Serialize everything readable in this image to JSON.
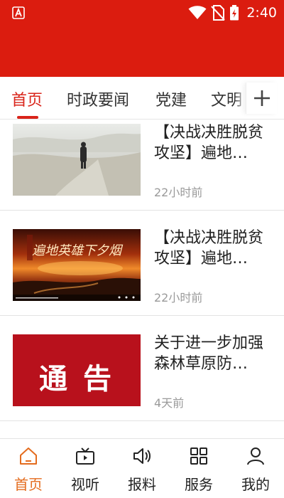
{
  "status_bar": {
    "time": "2:40",
    "left_icon": "app-notification-icon",
    "right_icons": [
      "wifi-icon",
      "no-sim-icon",
      "battery-charging-icon"
    ]
  },
  "tabs": [
    {
      "label": "首页",
      "active": true
    },
    {
      "label": "时政要闻",
      "active": false
    },
    {
      "label": "党建",
      "active": false
    },
    {
      "label": "文明",
      "active": false
    }
  ],
  "add_tab_icon": "plus-icon",
  "feed": [
    {
      "title": "【决战决胜脱贫攻坚】遍地…",
      "time": "22小时前",
      "thumb": "desert-walker"
    },
    {
      "title": "【决战决胜脱贫攻坚】遍地…",
      "time": "22小时前",
      "thumb": "sunset-video",
      "thumb_overlay_text": "遍地英雄下夕烟"
    },
    {
      "title": "关于进一步加强森林草原防…",
      "time": "4天前",
      "thumb": "notice-banner",
      "thumb_text": "通 告"
    }
  ],
  "bottom_nav": [
    {
      "label": "首页",
      "icon": "home-icon",
      "active": true
    },
    {
      "label": "视听",
      "icon": "video-icon",
      "active": false
    },
    {
      "label": "报料",
      "icon": "speaker-icon",
      "active": false
    },
    {
      "label": "服务",
      "icon": "grid-icon",
      "active": false
    },
    {
      "label": "我的",
      "icon": "user-icon",
      "active": false
    }
  ],
  "colors": {
    "brand_red": "#db1c0f",
    "active_tab": "#d9241a",
    "active_nav": "#e46c1e"
  }
}
